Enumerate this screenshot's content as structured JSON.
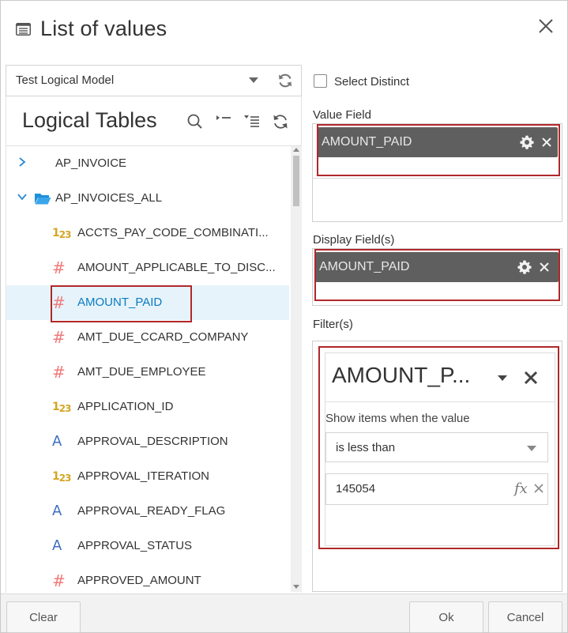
{
  "dialog": {
    "title": "List of values",
    "close_label": "close"
  },
  "left": {
    "model_select": {
      "value": "Test Logical Model"
    },
    "section_title": "Logical Tables",
    "tree": [
      {
        "kind": "table",
        "label": "AP_INVOICE",
        "expanded": false
      },
      {
        "kind": "table",
        "label": "AP_INVOICES_ALL",
        "expanded": true
      },
      {
        "kind": "column",
        "type": "integer",
        "type_glyph": "123",
        "label": "ACCTS_PAY_CODE_COMBINATI...",
        "selected": false
      },
      {
        "kind": "column",
        "type": "number",
        "type_glyph": "#",
        "label": "AMOUNT_APPLICABLE_TO_DISC...",
        "selected": false
      },
      {
        "kind": "column",
        "type": "number",
        "type_glyph": "#",
        "label": "AMOUNT_PAID",
        "selected": true
      },
      {
        "kind": "column",
        "type": "number",
        "type_glyph": "#",
        "label": "AMT_DUE_CCARD_COMPANY",
        "selected": false
      },
      {
        "kind": "column",
        "type": "number",
        "type_glyph": "#",
        "label": "AMT_DUE_EMPLOYEE",
        "selected": false
      },
      {
        "kind": "column",
        "type": "integer",
        "type_glyph": "123",
        "label": "APPLICATION_ID",
        "selected": false
      },
      {
        "kind": "column",
        "type": "string",
        "type_glyph": "A",
        "label": "APPROVAL_DESCRIPTION",
        "selected": false
      },
      {
        "kind": "column",
        "type": "integer",
        "type_glyph": "123",
        "label": "APPROVAL_ITERATION",
        "selected": false
      },
      {
        "kind": "column",
        "type": "string",
        "type_glyph": "A",
        "label": "APPROVAL_READY_FLAG",
        "selected": false
      },
      {
        "kind": "column",
        "type": "string",
        "type_glyph": "A",
        "label": "APPROVAL_STATUS",
        "selected": false
      },
      {
        "kind": "column",
        "type": "number",
        "type_glyph": "#",
        "label": "APPROVED_AMOUNT",
        "selected": false
      }
    ]
  },
  "right": {
    "select_distinct": {
      "label": "Select Distinct",
      "checked": false
    },
    "value_field": {
      "label": "Value Field",
      "pill": "AMOUNT_PAID"
    },
    "display_fields": {
      "label": "Display Field(s)",
      "pill": "AMOUNT_PAID"
    },
    "filters": {
      "label": "Filter(s)",
      "card": {
        "title": "AMOUNT_P...",
        "show_label": "Show items when the value",
        "operator": "is less than",
        "value": "145054",
        "fx_label": "fx"
      }
    }
  },
  "footer": {
    "clear_label": "Clear",
    "ok_label": "Ok",
    "cancel_label": "Cancel"
  },
  "colors": {
    "accent_blue": "#0a7bc1",
    "selected_row_bg": "#e6f3fb",
    "highlight_red": "#b0282a",
    "pill_bg": "#5f5f5f",
    "number_icon": "#ef7b7b",
    "integer_icon": "#d3a624",
    "string_icon": "#3d6fbf"
  }
}
